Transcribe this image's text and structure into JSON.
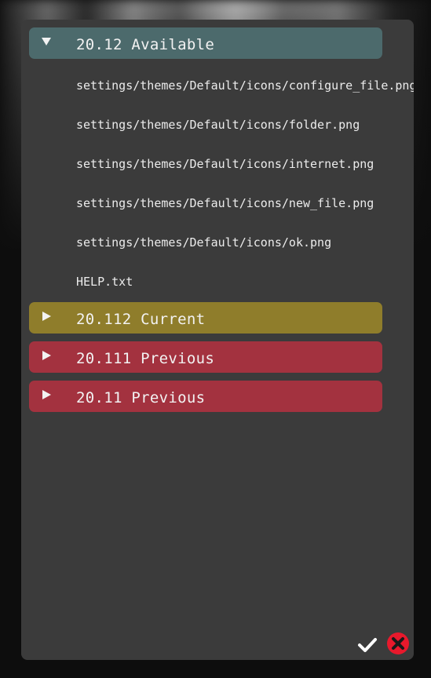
{
  "sections": [
    {
      "title": "20.12 Available",
      "expanded": true,
      "color": "#4c6a6c"
    },
    {
      "title": "20.112 Current",
      "expanded": false,
      "color": "#8f7d2b"
    },
    {
      "title": "20.111 Previous",
      "expanded": false,
      "color": "#a3323f"
    },
    {
      "title": "20.11 Previous",
      "expanded": false,
      "color": "#a3323f"
    }
  ],
  "files": [
    "settings/themes/Default/icons/configure_file.png",
    "settings/themes/Default/icons/folder.png",
    "settings/themes/Default/icons/internet.png",
    "settings/themes/Default/icons/new_file.png",
    "settings/themes/Default/icons/ok.png",
    "HELP.txt"
  ],
  "icons": {
    "expanded_arrow": "triangle-down-icon",
    "collapsed_arrow": "triangle-right-icon",
    "confirm": "checkmark-icon",
    "cancel": "close-circle-icon"
  },
  "colors": {
    "dialog_bg": "#3b3b3b",
    "cancel_red": "#e8192c"
  }
}
